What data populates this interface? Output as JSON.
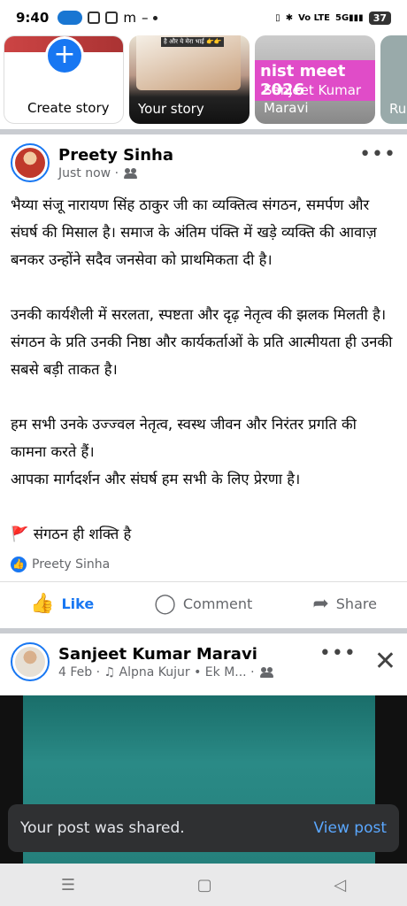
{
  "status": {
    "time": "9:40",
    "battery": "37"
  },
  "stories": {
    "create_label": "Create story",
    "yours_label": "Your story",
    "yours_caption": "है और ये मेरा भाई 👉👉",
    "sanjeet_banner": "nist meet 2026",
    "sanjeet_label": "Sanjeet Kumar Maravi",
    "rul_label": "Rul"
  },
  "post1": {
    "author": "Preety Sinha",
    "meta": "Just now ·",
    "text": "भैय्या संजू नारायण सिंह ठाकुर जी का व्यक्तित्व संगठन, समर्पण और संघर्ष की मिसाल है। समाज के अंतिम पंक्ति में खड़े व्यक्ति की आवाज़ बनकर उन्होंने सदैव जनसेवा को प्राथमिकता दी है।\n\nउनकी कार्यशैली में सरलता, स्पष्टता और दृढ़ नेतृत्व की झलक मिलती है। संगठन के प्रति उनकी निष्ठा और कार्यकर्ताओं के प्रति आत्मीयता ही उनकी सबसे बड़ी ताकत है।\n\nहम सभी उनके उज्ज्वल नेतृत्व, स्वस्थ जीवन और निरंतर प्रगति की कामना करते हैं।\nआपका मार्गदर्शन और संघर्ष हम सभी के लिए प्रेरणा है।\n\n🚩 संगठन ही शक्ति है",
    "reaction_name": "Preety Sinha",
    "like": "Like",
    "comment": "Comment",
    "share": "Share"
  },
  "post2": {
    "author": "Sanjeet Kumar Maravi",
    "meta": "4 Feb · ♫ Alpna Kujur • Ek M... ·"
  },
  "toast": {
    "message": "Your post was shared.",
    "action": "View post"
  },
  "colors": {
    "accent": "#1877f2"
  }
}
